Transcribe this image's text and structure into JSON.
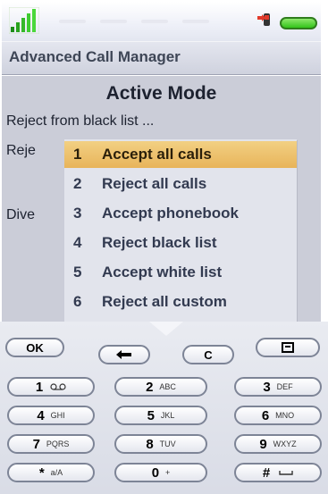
{
  "app": {
    "title": "Advanced Call Manager"
  },
  "screen": {
    "mode_title": "Active Mode",
    "row_black_list": "Reject from black list ...",
    "row_reject_partial": "Reje",
    "row_divert_partial": "Dive"
  },
  "menu": {
    "selected_index": 0,
    "items": [
      {
        "number": "1",
        "label": "Accept all calls"
      },
      {
        "number": "2",
        "label": "Reject all calls"
      },
      {
        "number": "3",
        "label": "Accept phonebook"
      },
      {
        "number": "4",
        "label": "Reject black list"
      },
      {
        "number": "5",
        "label": "Accept white list"
      },
      {
        "number": "6",
        "label": "Reject all custom"
      }
    ]
  },
  "keypad": {
    "ok": "OK",
    "clear": "C",
    "keys": [
      {
        "digit": "1",
        "sub": ""
      },
      {
        "digit": "2",
        "sub": "ABC"
      },
      {
        "digit": "3",
        "sub": "DEF"
      },
      {
        "digit": "4",
        "sub": "GHI"
      },
      {
        "digit": "5",
        "sub": "JKL"
      },
      {
        "digit": "6",
        "sub": "MNO"
      },
      {
        "digit": "7",
        "sub": "PQRS"
      },
      {
        "digit": "8",
        "sub": "TUV"
      },
      {
        "digit": "9",
        "sub": "WXYZ"
      },
      {
        "digit": "*",
        "sub": "a/A"
      },
      {
        "digit": "0",
        "sub": "+"
      },
      {
        "digit": "#",
        "sub": ""
      }
    ]
  },
  "icons": {
    "signal": "signal-strength-icon",
    "call_status": "call-status-icon",
    "battery": "battery-icon",
    "back": "back-arrow-icon",
    "menu_key": "menu-key-icon",
    "voicemail": "voicemail-icon",
    "space": "space-icon",
    "scroll_down": "scroll-down-arrow-icon"
  },
  "colors": {
    "screen_bg": "#cbcdd8",
    "menu_bg": "#e2e4ec",
    "highlight": "#e8b45a",
    "battery": "#33c41a"
  }
}
